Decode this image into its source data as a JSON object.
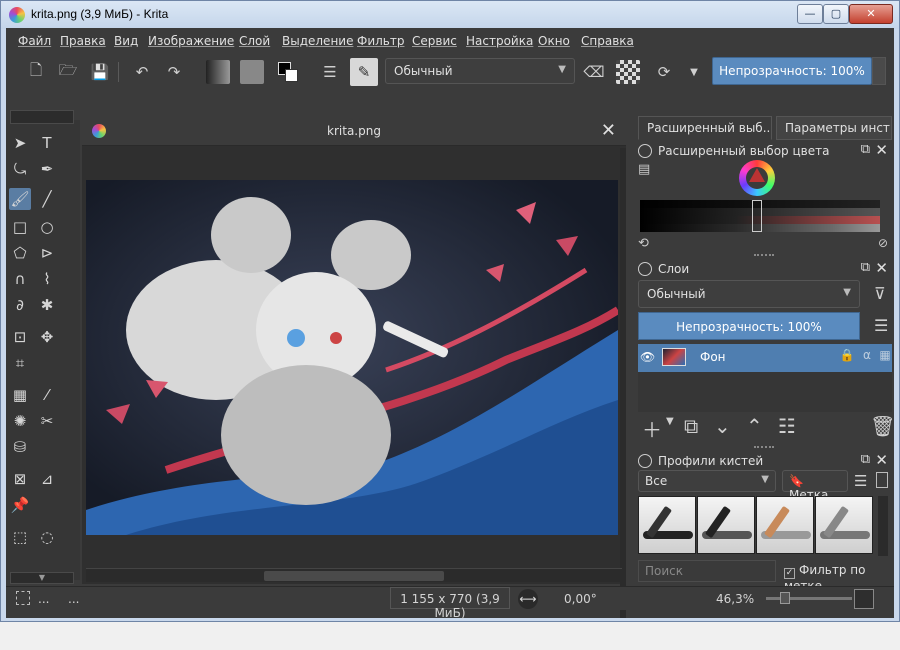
{
  "window": {
    "title": "krita.png (3,9 МиБ)  - Krita",
    "min": "—",
    "max": "▢",
    "close": "✕"
  },
  "menu": [
    "Файл",
    "Правка",
    "Вид",
    "Изображение",
    "Слой",
    "Выделение",
    "Фильтр",
    "Сервис",
    "Настройка",
    "Окно",
    "Справка"
  ],
  "toolbar": {
    "blend_mode": "Обычный",
    "opacity": "Непрозрачность: 100%"
  },
  "document": {
    "title": "krita.png",
    "close": "✕"
  },
  "dockers": {
    "tab_advanced_color": "Расширенный выб...",
    "tab_tool_options": "Параметры инст...",
    "color_title": "Расширенный выбор цвета",
    "layers_title": "Слои",
    "layer_blend": "Обычный",
    "layer_opacity": "Непрозрачность:  100%",
    "layer_name": "Фон",
    "brushes_title": "Профили кистей",
    "brush_filter": "Все",
    "tag_button": "Метка",
    "search_placeholder": "Поиск",
    "tag_filter_label": "Фильтр по метке"
  },
  "statusbar": {
    "dots_left": "...",
    "image_size": "1 155 x 770 (3,9 МиБ)",
    "rotation": "0,00°",
    "zoom": "46,3%"
  },
  "colors": {
    "accent": "#5a8bbf",
    "panel": "#3b3b3b",
    "selection": "#4f7eb0"
  },
  "icons": {
    "toolbar": [
      "new-document-icon",
      "open-icon",
      "save-icon",
      "undo-icon",
      "redo-icon",
      "gradient-icon",
      "pattern-icon",
      "fg-bg-color-icon",
      "brush-settings-icon",
      "brush-preset-icon",
      "eraser-icon",
      "alpha-lock-icon",
      "reload-icon"
    ],
    "tools": [
      "select-shapes-icon",
      "text-icon",
      "edit-shapes-icon",
      "calligraphy-icon",
      "freehand-brush-icon",
      "line-icon",
      "rectangle-icon",
      "ellipse-icon",
      "polygon-icon",
      "polyline-icon",
      "bezier-icon",
      "freehand-path-icon",
      "dynamic-brush-icon",
      "multibrush-icon",
      "transform-icon",
      "move-icon",
      "crop-icon",
      "gradient-tool-icon",
      "color-picker-icon",
      "colorize-mask-icon",
      "smart-patch-icon",
      "fill-icon",
      "assistant-icon",
      "measure-icon",
      "reference-icon",
      "rect-select-icon",
      "ellipse-select-icon"
    ]
  }
}
